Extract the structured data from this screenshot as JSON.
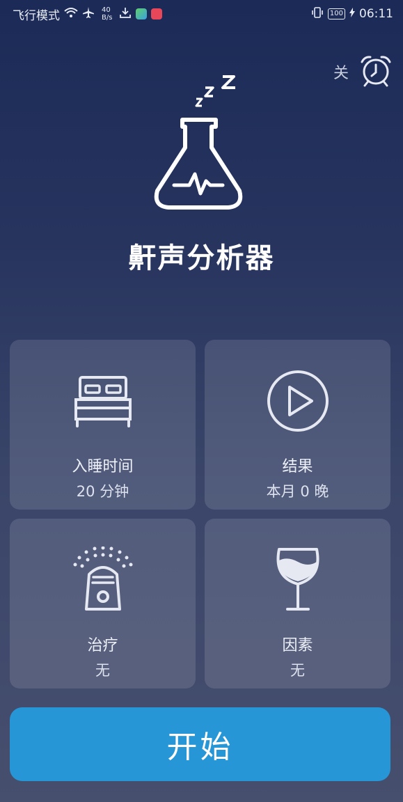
{
  "status_bar": {
    "carrier": "飞行模式",
    "speed_value": "40",
    "speed_unit": "B/s",
    "battery": "100",
    "time": "06:11"
  },
  "alarm": {
    "label": "关",
    "icon": "alarm-clock-icon"
  },
  "app": {
    "title": "鼾声分析器",
    "logo_icon": "flask-sleep-icon"
  },
  "cards": [
    {
      "title": "入睡时间",
      "value": "20 分钟",
      "icon": "bed-icon"
    },
    {
      "title": "结果",
      "value": "本月 0 晚",
      "icon": "play-circle-icon"
    },
    {
      "title": "治疗",
      "value": "无",
      "icon": "remedy-device-icon"
    },
    {
      "title": "因素",
      "value": "无",
      "icon": "wine-glass-icon"
    }
  ],
  "start_button": {
    "label": "开始"
  },
  "colors": {
    "accent": "#2696d6",
    "bg_top": "#1b2a57",
    "bg_bottom": "#474f6e"
  }
}
